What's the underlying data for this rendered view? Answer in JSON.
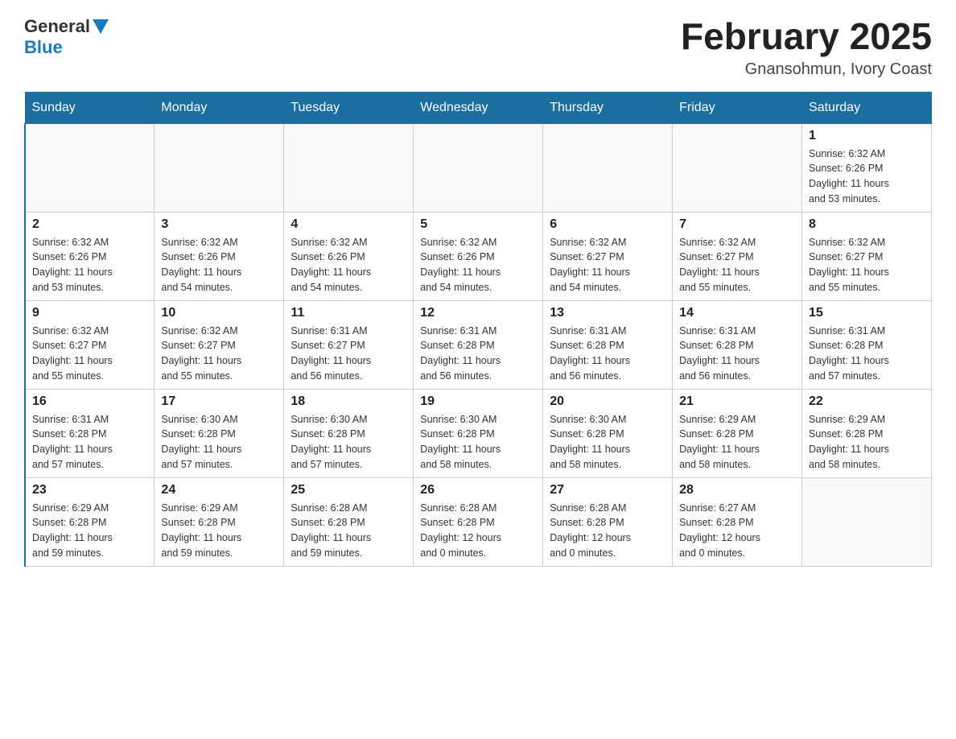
{
  "logo": {
    "general": "General",
    "blue": "Blue"
  },
  "header": {
    "month_year": "February 2025",
    "location": "Gnansohmun, Ivory Coast"
  },
  "days_of_week": [
    "Sunday",
    "Monday",
    "Tuesday",
    "Wednesday",
    "Thursday",
    "Friday",
    "Saturday"
  ],
  "weeks": [
    [
      {
        "day": "",
        "info": ""
      },
      {
        "day": "",
        "info": ""
      },
      {
        "day": "",
        "info": ""
      },
      {
        "day": "",
        "info": ""
      },
      {
        "day": "",
        "info": ""
      },
      {
        "day": "",
        "info": ""
      },
      {
        "day": "1",
        "info": "Sunrise: 6:32 AM\nSunset: 6:26 PM\nDaylight: 11 hours\nand 53 minutes."
      }
    ],
    [
      {
        "day": "2",
        "info": "Sunrise: 6:32 AM\nSunset: 6:26 PM\nDaylight: 11 hours\nand 53 minutes."
      },
      {
        "day": "3",
        "info": "Sunrise: 6:32 AM\nSunset: 6:26 PM\nDaylight: 11 hours\nand 54 minutes."
      },
      {
        "day": "4",
        "info": "Sunrise: 6:32 AM\nSunset: 6:26 PM\nDaylight: 11 hours\nand 54 minutes."
      },
      {
        "day": "5",
        "info": "Sunrise: 6:32 AM\nSunset: 6:26 PM\nDaylight: 11 hours\nand 54 minutes."
      },
      {
        "day": "6",
        "info": "Sunrise: 6:32 AM\nSunset: 6:27 PM\nDaylight: 11 hours\nand 54 minutes."
      },
      {
        "day": "7",
        "info": "Sunrise: 6:32 AM\nSunset: 6:27 PM\nDaylight: 11 hours\nand 55 minutes."
      },
      {
        "day": "8",
        "info": "Sunrise: 6:32 AM\nSunset: 6:27 PM\nDaylight: 11 hours\nand 55 minutes."
      }
    ],
    [
      {
        "day": "9",
        "info": "Sunrise: 6:32 AM\nSunset: 6:27 PM\nDaylight: 11 hours\nand 55 minutes."
      },
      {
        "day": "10",
        "info": "Sunrise: 6:32 AM\nSunset: 6:27 PM\nDaylight: 11 hours\nand 55 minutes."
      },
      {
        "day": "11",
        "info": "Sunrise: 6:31 AM\nSunset: 6:27 PM\nDaylight: 11 hours\nand 56 minutes."
      },
      {
        "day": "12",
        "info": "Sunrise: 6:31 AM\nSunset: 6:28 PM\nDaylight: 11 hours\nand 56 minutes."
      },
      {
        "day": "13",
        "info": "Sunrise: 6:31 AM\nSunset: 6:28 PM\nDaylight: 11 hours\nand 56 minutes."
      },
      {
        "day": "14",
        "info": "Sunrise: 6:31 AM\nSunset: 6:28 PM\nDaylight: 11 hours\nand 56 minutes."
      },
      {
        "day": "15",
        "info": "Sunrise: 6:31 AM\nSunset: 6:28 PM\nDaylight: 11 hours\nand 57 minutes."
      }
    ],
    [
      {
        "day": "16",
        "info": "Sunrise: 6:31 AM\nSunset: 6:28 PM\nDaylight: 11 hours\nand 57 minutes."
      },
      {
        "day": "17",
        "info": "Sunrise: 6:30 AM\nSunset: 6:28 PM\nDaylight: 11 hours\nand 57 minutes."
      },
      {
        "day": "18",
        "info": "Sunrise: 6:30 AM\nSunset: 6:28 PM\nDaylight: 11 hours\nand 57 minutes."
      },
      {
        "day": "19",
        "info": "Sunrise: 6:30 AM\nSunset: 6:28 PM\nDaylight: 11 hours\nand 58 minutes."
      },
      {
        "day": "20",
        "info": "Sunrise: 6:30 AM\nSunset: 6:28 PM\nDaylight: 11 hours\nand 58 minutes."
      },
      {
        "day": "21",
        "info": "Sunrise: 6:29 AM\nSunset: 6:28 PM\nDaylight: 11 hours\nand 58 minutes."
      },
      {
        "day": "22",
        "info": "Sunrise: 6:29 AM\nSunset: 6:28 PM\nDaylight: 11 hours\nand 58 minutes."
      }
    ],
    [
      {
        "day": "23",
        "info": "Sunrise: 6:29 AM\nSunset: 6:28 PM\nDaylight: 11 hours\nand 59 minutes."
      },
      {
        "day": "24",
        "info": "Sunrise: 6:29 AM\nSunset: 6:28 PM\nDaylight: 11 hours\nand 59 minutes."
      },
      {
        "day": "25",
        "info": "Sunrise: 6:28 AM\nSunset: 6:28 PM\nDaylight: 11 hours\nand 59 minutes."
      },
      {
        "day": "26",
        "info": "Sunrise: 6:28 AM\nSunset: 6:28 PM\nDaylight: 12 hours\nand 0 minutes."
      },
      {
        "day": "27",
        "info": "Sunrise: 6:28 AM\nSunset: 6:28 PM\nDaylight: 12 hours\nand 0 minutes."
      },
      {
        "day": "28",
        "info": "Sunrise: 6:27 AM\nSunset: 6:28 PM\nDaylight: 12 hours\nand 0 minutes."
      },
      {
        "day": "",
        "info": ""
      }
    ]
  ]
}
